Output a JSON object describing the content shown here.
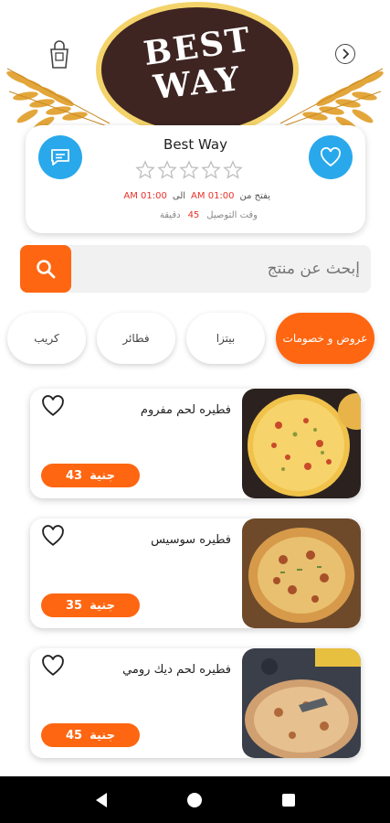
{
  "header": {
    "logo_line1": "BEST",
    "logo_line2": "WAY",
    "bag_icon": "shopping-bag-icon",
    "back_icon": "chevron-right-icon"
  },
  "store": {
    "name": "Best Way",
    "rating": 0,
    "rating_max": 5,
    "opens_label": "يفتح من",
    "open_time": "01:00 AM",
    "until_label": "الى",
    "close_time": "01:00 AM",
    "delivery_label": "وقت التوصيل",
    "delivery_value": "45",
    "delivery_unit": "دقيقة"
  },
  "search": {
    "placeholder": "إبحث عن منتج"
  },
  "tabs": [
    {
      "label": "عروض و خصومات",
      "active": true
    },
    {
      "label": "بيتزا",
      "active": false
    },
    {
      "label": "فطائر",
      "active": false
    },
    {
      "label": "كريب",
      "active": false
    }
  ],
  "products": [
    {
      "name": "فطيره لحم مفروم",
      "price": "43",
      "currency": "جنية"
    },
    {
      "name": "فطيره سوسيس",
      "price": "35",
      "currency": "جنية"
    },
    {
      "name": "فطيره لحم ديك رومي",
      "price": "45",
      "currency": "جنية"
    }
  ],
  "colors": {
    "accent": "#fe6611",
    "blue": "#29a8ec",
    "logo_bg": "#3e2522",
    "logo_ring": "#f3d36a",
    "highlight_red": "#e8322a"
  }
}
